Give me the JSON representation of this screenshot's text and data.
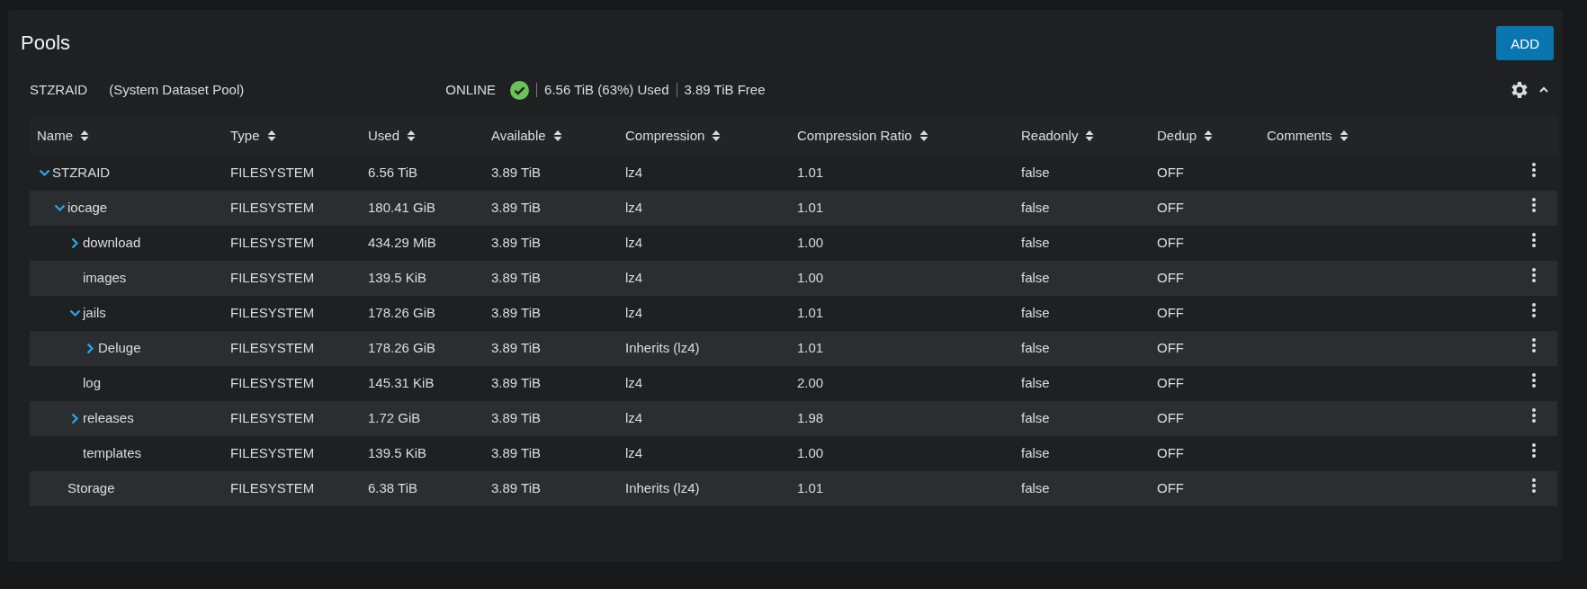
{
  "title": "Pools",
  "add_button": "ADD",
  "pool": {
    "name": "STZRAID",
    "description": "(System Dataset Pool)",
    "status": "ONLINE",
    "used": "6.56 TiB (63%) Used",
    "free": "3.89 TiB Free",
    "expanded": true
  },
  "table": {
    "columns": [
      "Name",
      "Type",
      "Used",
      "Available",
      "Compression",
      "Compression Ratio",
      "Readonly",
      "Dedup",
      "Comments"
    ],
    "rows": [
      {
        "name": "STZRAID",
        "type": "FILESYSTEM",
        "used": "6.56 TiB",
        "available": "3.89 TiB",
        "compression": "lz4",
        "ratio": "1.01",
        "readonly": "false",
        "dedup": "OFF",
        "expanded": true,
        "children": [
          {
            "name": "iocage",
            "type": "FILESYSTEM",
            "used": "180.41 GiB",
            "available": "3.89 TiB",
            "compression": "lz4",
            "ratio": "1.01",
            "readonly": "false",
            "dedup": "OFF",
            "expanded": true,
            "children": [
              {
                "name": "download",
                "type": "FILESYSTEM",
                "used": "434.29 MiB",
                "available": "3.89 TiB",
                "compression": "lz4",
                "ratio": "1.00",
                "readonly": "false",
                "dedup": "OFF",
                "expanded": false
              },
              {
                "name": "images",
                "type": "FILESYSTEM",
                "used": "139.5 KiB",
                "available": "3.89 TiB",
                "compression": "lz4",
                "ratio": "1.00",
                "readonly": "false",
                "dedup": "OFF"
              },
              {
                "name": "jails",
                "type": "FILESYSTEM",
                "used": "178.26 GiB",
                "available": "3.89 TiB",
                "compression": "lz4",
                "ratio": "1.01",
                "readonly": "false",
                "dedup": "OFF",
                "expanded": true,
                "children": [
                  {
                    "name": "Deluge",
                    "type": "FILESYSTEM",
                    "used": "178.26 GiB",
                    "available": "3.89 TiB",
                    "compression": "Inherits (lz4)",
                    "ratio": "1.01",
                    "readonly": "false",
                    "dedup": "OFF",
                    "expanded": false
                  }
                ]
              },
              {
                "name": "log",
                "type": "FILESYSTEM",
                "used": "145.31 KiB",
                "available": "3.89 TiB",
                "compression": "lz4",
                "ratio": "2.00",
                "readonly": "false",
                "dedup": "OFF"
              },
              {
                "name": "releases",
                "type": "FILESYSTEM",
                "used": "1.72 GiB",
                "available": "3.89 TiB",
                "compression": "lz4",
                "ratio": "1.98",
                "readonly": "false",
                "dedup": "OFF",
                "expanded": false
              },
              {
                "name": "templates",
                "type": "FILESYSTEM",
                "used": "139.5 KiB",
                "available": "3.89 TiB",
                "compression": "lz4",
                "ratio": "1.00",
                "readonly": "false",
                "dedup": "OFF"
              }
            ]
          },
          {
            "name": "Storage",
            "type": "FILESYSTEM",
            "used": "6.38 TiB",
            "available": "3.89 TiB",
            "compression": "Inherits (lz4)",
            "ratio": "1.01",
            "readonly": "false",
            "dedup": "OFF"
          }
        ]
      }
    ]
  }
}
